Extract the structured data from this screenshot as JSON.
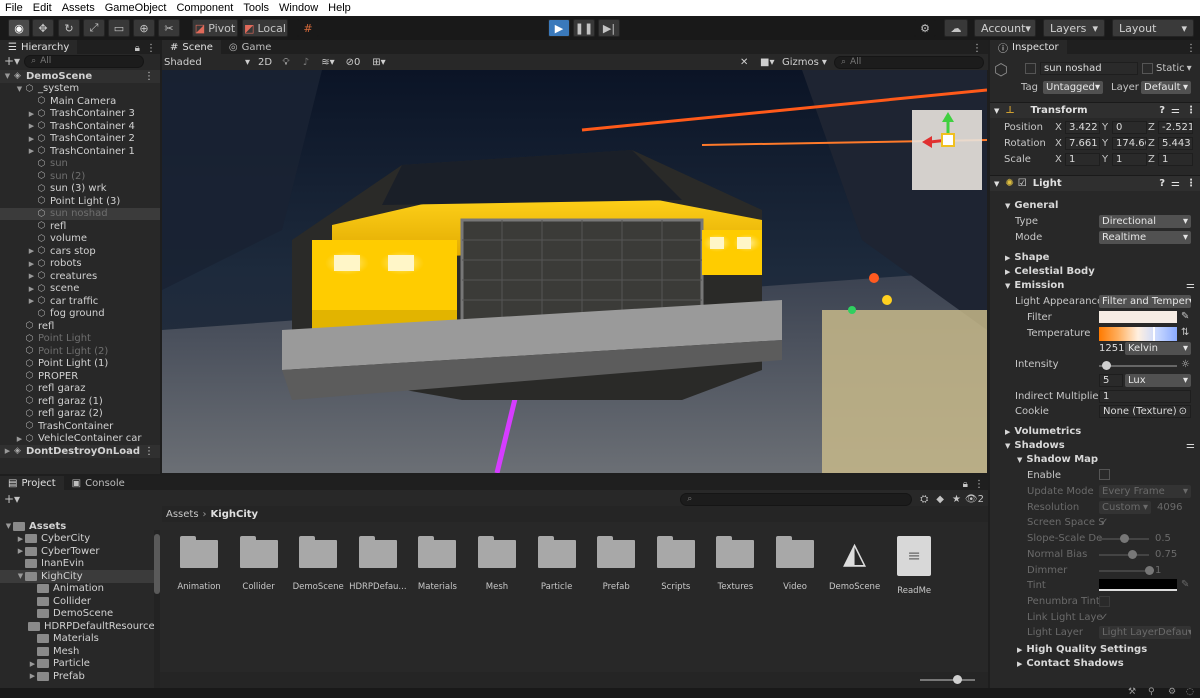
{
  "menu": [
    "File",
    "Edit",
    "Assets",
    "GameObject",
    "Component",
    "Tools",
    "Window",
    "Help"
  ],
  "toolbar": {
    "pivot": "Pivot",
    "local": "Local",
    "account": "Account",
    "layers": "Layers",
    "layout": "Layout"
  },
  "hierarchy": {
    "tab": "Hierarchy",
    "search_placeholder": "All",
    "items": [
      {
        "label": "DemoScene",
        "indent": 0,
        "tri": "▼",
        "dim": false,
        "sel": false,
        "scene": true
      },
      {
        "label": "_system",
        "indent": 1,
        "tri": "▼",
        "dim": false,
        "sel": false
      },
      {
        "label": "Main Camera",
        "indent": 2,
        "tri": "",
        "dim": false,
        "sel": false
      },
      {
        "label": "TrashContainer 3",
        "indent": 2,
        "tri": "▶",
        "dim": false,
        "sel": false
      },
      {
        "label": "TrashContainer 4",
        "indent": 2,
        "tri": "▶",
        "dim": false,
        "sel": false
      },
      {
        "label": "TrashContainer 2",
        "indent": 2,
        "tri": "▶",
        "dim": false,
        "sel": false
      },
      {
        "label": "TrashContainer 1",
        "indent": 2,
        "tri": "▶",
        "dim": false,
        "sel": false
      },
      {
        "label": "sun",
        "indent": 2,
        "tri": "",
        "dim": true,
        "sel": false
      },
      {
        "label": "sun (2)",
        "indent": 2,
        "tri": "",
        "dim": true,
        "sel": false
      },
      {
        "label": "sun (3) wrk",
        "indent": 2,
        "tri": "",
        "dim": false,
        "sel": false
      },
      {
        "label": "Point Light (3)",
        "indent": 2,
        "tri": "",
        "dim": false,
        "sel": false
      },
      {
        "label": "sun noshad",
        "indent": 2,
        "tri": "",
        "dim": true,
        "sel": true
      },
      {
        "label": "refl",
        "indent": 2,
        "tri": "",
        "dim": false,
        "sel": false
      },
      {
        "label": "volume",
        "indent": 2,
        "tri": "",
        "dim": false,
        "sel": false
      },
      {
        "label": "cars stop",
        "indent": 2,
        "tri": "▶",
        "dim": false,
        "sel": false
      },
      {
        "label": "robots",
        "indent": 2,
        "tri": "▶",
        "dim": false,
        "sel": false
      },
      {
        "label": "creatures",
        "indent": 2,
        "tri": "▶",
        "dim": false,
        "sel": false
      },
      {
        "label": "scene",
        "indent": 2,
        "tri": "▶",
        "dim": false,
        "sel": false
      },
      {
        "label": "car traffic",
        "indent": 2,
        "tri": "▶",
        "dim": false,
        "sel": false
      },
      {
        "label": "fog ground",
        "indent": 2,
        "tri": "",
        "dim": false,
        "sel": false
      },
      {
        "label": "refl",
        "indent": 1,
        "tri": "",
        "dim": false,
        "sel": false
      },
      {
        "label": "Point Light",
        "indent": 1,
        "tri": "",
        "dim": true,
        "sel": false
      },
      {
        "label": "Point Light (2)",
        "indent": 1,
        "tri": "",
        "dim": true,
        "sel": false
      },
      {
        "label": "Point Light (1)",
        "indent": 1,
        "tri": "",
        "dim": false,
        "sel": false
      },
      {
        "label": "PROPER",
        "indent": 1,
        "tri": "",
        "dim": false,
        "sel": false
      },
      {
        "label": "refl garaz",
        "indent": 1,
        "tri": "",
        "dim": false,
        "sel": false
      },
      {
        "label": "refl garaz (1)",
        "indent": 1,
        "tri": "",
        "dim": false,
        "sel": false
      },
      {
        "label": "refl garaz (2)",
        "indent": 1,
        "tri": "",
        "dim": false,
        "sel": false
      },
      {
        "label": "TrashContainer",
        "indent": 1,
        "tri": "",
        "dim": false,
        "sel": false
      },
      {
        "label": "VehicleContainer car",
        "indent": 1,
        "tri": "▶",
        "dim": false,
        "sel": false
      },
      {
        "label": "DontDestroyOnLoad",
        "indent": 0,
        "tri": "▶",
        "dim": false,
        "sel": false,
        "scene": true
      }
    ]
  },
  "scene": {
    "tab_scene": "Scene",
    "tab_game": "Game",
    "shading": "Shaded",
    "mode2d": "2D",
    "hidden_count": "0",
    "gizmos": "Gizmos",
    "search_placeholder": "All"
  },
  "project": {
    "tab_project": "Project",
    "tab_console": "Console",
    "badge_count": "2",
    "breadcrumb": [
      "Assets",
      "KighCity"
    ],
    "tree": [
      {
        "label": "Assets",
        "indent": 0,
        "tri": "▼",
        "bold": true
      },
      {
        "label": "CyberCity",
        "indent": 1,
        "tri": "▶",
        "bold": false
      },
      {
        "label": "CyberTower",
        "indent": 1,
        "tri": "▶",
        "bold": false
      },
      {
        "label": "InanEvin",
        "indent": 1,
        "tri": "",
        "bold": false
      },
      {
        "label": "KighCity",
        "indent": 1,
        "tri": "▼",
        "bold": false,
        "sel": true
      },
      {
        "label": "Animation",
        "indent": 2,
        "tri": "",
        "bold": false
      },
      {
        "label": "Collider",
        "indent": 2,
        "tri": "",
        "bold": false
      },
      {
        "label": "DemoScene",
        "indent": 2,
        "tri": "",
        "bold": false
      },
      {
        "label": "HDRPDefaultResource",
        "indent": 2,
        "tri": "",
        "bold": false
      },
      {
        "label": "Materials",
        "indent": 2,
        "tri": "",
        "bold": false
      },
      {
        "label": "Mesh",
        "indent": 2,
        "tri": "",
        "bold": false
      },
      {
        "label": "Particle",
        "indent": 2,
        "tri": "▶",
        "bold": false
      },
      {
        "label": "Prefab",
        "indent": 2,
        "tri": "▶",
        "bold": false
      }
    ],
    "assets": [
      {
        "label": "Animation",
        "kind": "folder"
      },
      {
        "label": "Collider",
        "kind": "folder"
      },
      {
        "label": "DemoScene",
        "kind": "folder"
      },
      {
        "label": "HDRPDefau...",
        "kind": "folder"
      },
      {
        "label": "Materials",
        "kind": "folder"
      },
      {
        "label": "Mesh",
        "kind": "folder"
      },
      {
        "label": "Particle",
        "kind": "folder"
      },
      {
        "label": "Prefab",
        "kind": "folder"
      },
      {
        "label": "Scripts",
        "kind": "folder"
      },
      {
        "label": "Textures",
        "kind": "folder"
      },
      {
        "label": "Video",
        "kind": "folder"
      },
      {
        "label": "DemoScene",
        "kind": "unity"
      },
      {
        "label": "ReadMe",
        "kind": "doc"
      }
    ]
  },
  "inspector": {
    "tab": "Inspector",
    "object_name": "sun noshad",
    "static": "Static",
    "tag_label": "Tag",
    "tag": "Untagged",
    "layer_label": "Layer",
    "layer": "Default",
    "transform": {
      "title": "Transform",
      "position": {
        "label": "Position",
        "x": "3.422",
        "y": "0",
        "z": "-2.521"
      },
      "rotation": {
        "label": "Rotation",
        "x": "7.661",
        "y": "174.66",
        "z": "5.443"
      },
      "scale": {
        "label": "Scale",
        "x": "1",
        "y": "1",
        "z": "1"
      }
    },
    "light": {
      "title": "Light",
      "general": "General",
      "type_label": "Type",
      "type": "Directional",
      "mode_label": "Mode",
      "mode": "Realtime",
      "shape": "Shape",
      "celestial": "Celestial Body",
      "emission": "Emission",
      "appearance_label": "Light Appearance",
      "appearance": "Filter and Temper",
      "filter_label": "Filter",
      "temperature_label": "Temperature",
      "kelvin_value": "1251",
      "kelvin_unit": "Kelvin",
      "intensity_label": "Intensity",
      "intensity": "5",
      "intensity_unit": "Lux",
      "indirect_label": "Indirect Multiplier",
      "indirect": "1",
      "cookie_label": "Cookie",
      "cookie": "None (Texture)",
      "volumetrics": "Volumetrics",
      "shadows": "Shadows",
      "shadow_map": "Shadow Map",
      "enable_label": "Enable",
      "update_label": "Update Mode",
      "update": "Every Frame",
      "resolution_label": "Resolution",
      "resolution": "Custom",
      "resolution_value": "4096",
      "screen_space_label": "Screen Space S",
      "slope_label": "Slope-Scale De",
      "slope": "0.5",
      "normal_label": "Normal Bias",
      "normal": "0.75",
      "dimmer_label": "Dimmer",
      "dimmer": "1",
      "tint_label": "Tint",
      "penumbra_label": "Penumbra Tint",
      "link_label": "Link Light Laye",
      "light_layer_label": "Light Layer",
      "light_layer": "Light LayerDefau",
      "hq": "High Quality Settings",
      "contact": "Contact Shadows"
    }
  },
  "colors": {
    "accent": "#3a79bb",
    "filter": "#f6ece4",
    "tint": "#000000"
  }
}
